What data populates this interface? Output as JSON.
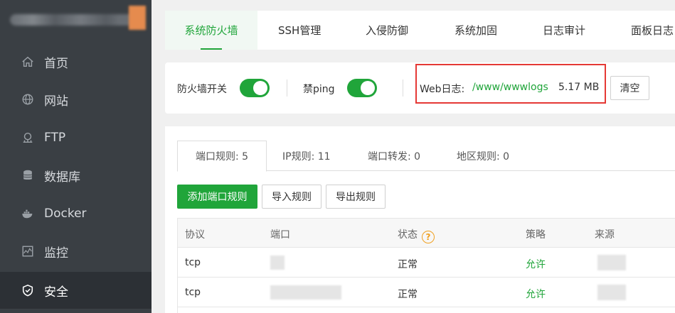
{
  "sidebar": {
    "items": [
      {
        "label": "首页",
        "icon": "home-icon"
      },
      {
        "label": "网站",
        "icon": "globe-icon"
      },
      {
        "label": "FTP",
        "icon": "ftp-icon"
      },
      {
        "label": "数据库",
        "icon": "database-icon"
      },
      {
        "label": "Docker",
        "icon": "docker-icon"
      },
      {
        "label": "监控",
        "icon": "monitor-icon"
      },
      {
        "label": "安全",
        "icon": "shield-icon",
        "active": true
      }
    ]
  },
  "top_tabs": [
    "系统防火墙",
    "SSH管理",
    "入侵防御",
    "系统加固",
    "日志审计",
    "面板日志"
  ],
  "firewall": {
    "switch_label": "防火墙开关",
    "ping_label": "禁ping",
    "weblog_title": "Web日志:",
    "weblog_path": "/www/wwwlogs",
    "weblog_size": "5.17 MB",
    "clear_label": "清空"
  },
  "rule_tabs": [
    "端口规则: 5",
    "IP规则: 11",
    "端口转发: 0",
    "地区规则: 0"
  ],
  "actions": {
    "add_port_rule": "添加端口规则",
    "import_rules": "导入规则",
    "export_rules": "导出规则"
  },
  "table": {
    "headers": [
      "协议",
      "端口",
      "状态",
      "策略",
      "来源"
    ],
    "help_mark": "?",
    "rows": [
      {
        "protocol": "tcp",
        "status": "正常",
        "policy": "允许"
      },
      {
        "protocol": "tcp",
        "status": "正常",
        "policy": "允许"
      }
    ]
  },
  "colors": {
    "accent": "#20a53a",
    "sidebar_bg": "#3a3f44",
    "sidebar_active": "#2c3035",
    "highlight": "#e53935"
  }
}
